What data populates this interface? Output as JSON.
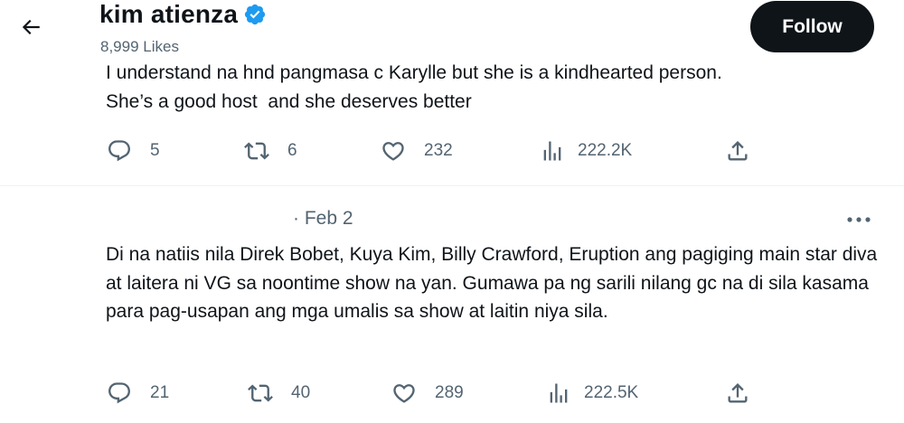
{
  "header": {
    "name": "kim atienza",
    "likes": "8,999 Likes",
    "follow_label": "Follow"
  },
  "tweets": [
    {
      "text": "I understand na hnd pangmasa c Karylle but she is a kindhearted person.\nShe’s a good host  and she deserves better",
      "replies": "5",
      "retweets": "6",
      "likes": "232",
      "views": "222.2K"
    },
    {
      "date": "· Feb 2",
      "text": "Di na natiis nila Direk Bobet, Kuya Kim, Billy Crawford, Eruption ang pagiging main star diva at laitera ni VG sa noontime show na yan. Gumawa pa ng sarili nilang gc na di sila kasama para pag-usapan ang mga umalis sa show at laitin niya sila.",
      "replies": "21",
      "retweets": "40",
      "likes": "289",
      "views": "222.5K"
    }
  ],
  "colors": {
    "text": "#0f1419",
    "muted": "#536471",
    "verified": "#1d9bf0",
    "follow_bg": "#0f1419",
    "divider": "#eff3f4"
  },
  "icons": [
    "back-arrow-icon",
    "verified-badge-icon",
    "reply-icon",
    "retweet-icon",
    "like-icon",
    "views-icon",
    "share-icon",
    "more-icon"
  ]
}
